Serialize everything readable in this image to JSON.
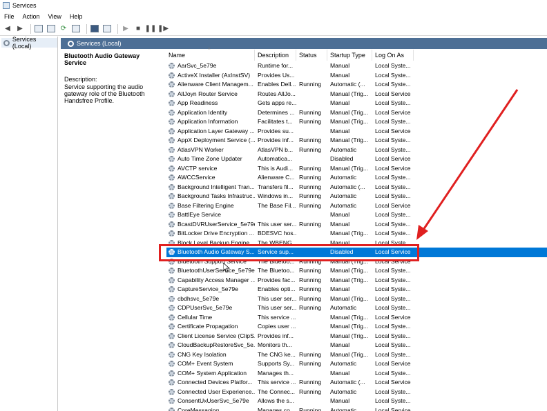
{
  "window": {
    "title": "Services"
  },
  "menu": [
    "File",
    "Action",
    "View",
    "Help"
  ],
  "toolbar": {
    "icons": [
      "back-icon",
      "forward-icon",
      "console-tree-icon",
      "properties-icon",
      "refresh-icon",
      "export-icon",
      "help-icon",
      "view-icon",
      "start-icon",
      "stop-icon",
      "pause-icon",
      "restart-icon"
    ]
  },
  "tree": {
    "item": "Services (Local)"
  },
  "panel_header": "Services (Local)",
  "description_pane": {
    "title": "Bluetooth Audio Gateway Service",
    "label": "Description:",
    "text": "Service supporting the audio gateway role of the Bluetooth Handsfree Profile."
  },
  "columns": [
    "Name",
    "Description",
    "Status",
    "Startup Type",
    "Log On As"
  ],
  "rows": [
    [
      "AarSvc_5e79e",
      "Runtime for...",
      "",
      "Manual",
      "Local Syste..."
    ],
    [
      "ActiveX Installer (AxInstSV)",
      "Provides Us...",
      "",
      "Manual",
      "Local Syste..."
    ],
    [
      "Alienware Client Managem...",
      "Enables Dell...",
      "Running",
      "Automatic (...",
      "Local Syste..."
    ],
    [
      "AllJoyn Router Service",
      "Routes AllJo...",
      "",
      "Manual (Trig...",
      "Local Service"
    ],
    [
      "App Readiness",
      "Gets apps re...",
      "",
      "Manual",
      "Local Syste..."
    ],
    [
      "Application Identity",
      "Determines ...",
      "Running",
      "Manual (Trig...",
      "Local Service"
    ],
    [
      "Application Information",
      "Facilitates t...",
      "Running",
      "Manual (Trig...",
      "Local Syste..."
    ],
    [
      "Application Layer Gateway ...",
      "Provides su...",
      "",
      "Manual",
      "Local Service"
    ],
    [
      "AppX Deployment Service (...",
      "Provides inf...",
      "Running",
      "Manual (Trig...",
      "Local Syste..."
    ],
    [
      "AtlasVPN Worker",
      "AtlasVPN b...",
      "Running",
      "Automatic",
      "Local Syste..."
    ],
    [
      "Auto Time Zone Updater",
      "Automatica...",
      "",
      "Disabled",
      "Local Service"
    ],
    [
      "AVCTP service",
      "This is Audi...",
      "Running",
      "Manual (Trig...",
      "Local Service"
    ],
    [
      "AWCCService",
      "Alienware C...",
      "Running",
      "Automatic",
      "Local Syste..."
    ],
    [
      "Background Intelligent Tran...",
      "Transfers fil...",
      "Running",
      "Automatic (...",
      "Local Syste..."
    ],
    [
      "Background Tasks Infrastruc...",
      "Windows in...",
      "Running",
      "Automatic",
      "Local Syste..."
    ],
    [
      "Base Filtering Engine",
      "The Base Fil...",
      "Running",
      "Automatic",
      "Local Service"
    ],
    [
      "BattlEye Service",
      "",
      "",
      "Manual",
      "Local Syste..."
    ],
    [
      "BcastDVRUserService_5e79e",
      "This user ser...",
      "Running",
      "Manual",
      "Local Syste..."
    ],
    [
      "BitLocker Drive Encryption ...",
      "BDESVC hos...",
      "",
      "Manual (Trig...",
      "Local Syste..."
    ],
    [
      "Block Level Backup Engine ...",
      "The WBENG...",
      "",
      "Manual",
      "Local Syste..."
    ],
    [
      "Bluetooth Audio Gateway S...",
      "Service sup...",
      "",
      "Disabled",
      "Local Service"
    ],
    [
      "Bluetooth Support Service",
      "The Bluetoo...",
      "Running",
      "Manual (Trig...",
      "Local Service"
    ],
    [
      "BluetoothUserService_5e79e",
      "The Bluetoo...",
      "Running",
      "Manual (Trig...",
      "Local Syste..."
    ],
    [
      "Capability Access Manager ...",
      "Provides fac...",
      "Running",
      "Manual (Trig...",
      "Local Syste..."
    ],
    [
      "CaptureService_5e79e",
      "Enables opti...",
      "Running",
      "Manual",
      "Local Syste..."
    ],
    [
      "cbdhsvc_5e79e",
      "This user ser...",
      "Running",
      "Manual (Trig...",
      "Local Syste..."
    ],
    [
      "CDPUserSvc_5e79e",
      "This user ser...",
      "Running",
      "Automatic",
      "Local Syste..."
    ],
    [
      "Cellular Time",
      "This service ...",
      "",
      "Manual (Trig...",
      "Local Service"
    ],
    [
      "Certificate Propagation",
      "Copies user ...",
      "",
      "Manual (Trig...",
      "Local Syste..."
    ],
    [
      "Client License Service (ClipS...",
      "Provides inf...",
      "",
      "Manual (Trig...",
      "Local Syste..."
    ],
    [
      "CloudBackupRestoreSvc_5e...",
      "Monitors th...",
      "",
      "Manual",
      "Local Syste..."
    ],
    [
      "CNG Key Isolation",
      "The CNG ke...",
      "Running",
      "Manual (Trig...",
      "Local Syste..."
    ],
    [
      "COM+ Event System",
      "Supports Sy...",
      "Running",
      "Automatic",
      "Local Service"
    ],
    [
      "COM+ System Application",
      "Manages th...",
      "",
      "Manual",
      "Local Syste..."
    ],
    [
      "Connected Devices Platfor...",
      "This service ...",
      "Running",
      "Automatic (...",
      "Local Service"
    ],
    [
      "Connected User Experience...",
      "The Connec...",
      "Running",
      "Automatic",
      "Local Syste..."
    ],
    [
      "ConsentUxUserSvc_5e79e",
      "Allows the s...",
      "",
      "Manual",
      "Local Syste..."
    ],
    [
      "CoreMessaging",
      "Manages co...",
      "Running",
      "Automatic",
      "Local Service"
    ]
  ],
  "selected_index": 20,
  "colors": {
    "selected": "#0078d7",
    "header": "#4d6f95",
    "annotation": "#e02020"
  }
}
